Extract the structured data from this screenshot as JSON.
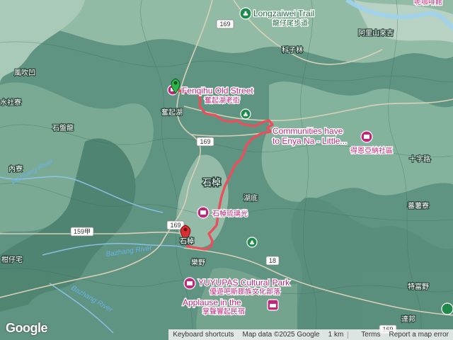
{
  "attribution": {
    "keyboard_shortcuts": "Keyboard shortcuts",
    "map_data": "Map data ©2025 Google",
    "scale": "1 km",
    "terms": "Terms",
    "report": "Report a map error"
  },
  "logo": "Google",
  "places": {
    "trail_en": "Longzaiwei Trail",
    "trail_zh": "龍仔尾步道",
    "fenqihu_en": "Fenqihu Old Street",
    "fenqihu_zh": "奮起湖老街",
    "fenqihu_town": "奮起湖",
    "enyana_en_1": "Communities have",
    "enyana_en_2": "to Enya Na - Little...",
    "enyana_zh": "得恩亞納社區",
    "shizhuo_big": "石棹",
    "glass_zh": "石棹琉璃光",
    "shizhuo_small": "石棹",
    "yuyupas_en": "YUYUPAS Cultural Park",
    "yuyupas_zh": "優遊吧斯鄒族文化部落",
    "applause_en": "Applause in the",
    "applause_zh": "掌聲響起民宿",
    "top_right_partial": "呢咖啡館",
    "alishan_lai_ji": "阿里山來吉",
    "kezilin": "科子林",
    "fengchuiao": "風吹凹",
    "shuishelia": "水社寮",
    "shipanlong": "石盤龍",
    "neiliao": "內寮",
    "hudi": "湖底",
    "shiziliu": "十字路",
    "fanshuliao": "蕃薯寮",
    "leye": "樂野",
    "ganzailiao": "柑仔宅",
    "tefuye": "特富野",
    "dabang": "達邦",
    "river1": "Bazhang River",
    "river2": "Bazhang River",
    "river3": "Bazhang River"
  },
  "roads": {
    "r169_top": "169",
    "r169_mid": "169",
    "r169_low": "169",
    "r159a": "159甲",
    "r18": "18",
    "r169_bottom": "169"
  },
  "route": {
    "color": "#e8505b",
    "start": "Fenqihu Old Street",
    "end": "石棹"
  }
}
